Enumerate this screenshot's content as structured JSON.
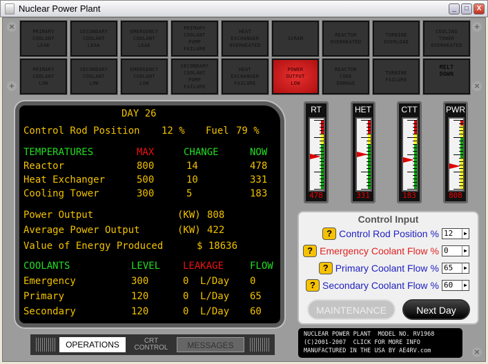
{
  "window": {
    "title": "Nuclear Power Plant",
    "min": "_",
    "max": "□",
    "close": "X"
  },
  "alarms": [
    {
      "label": "PRIMARY\nCOOLANT\nLEAK",
      "active": false
    },
    {
      "label": "SECONDARY\nCOOLANT\nLEAK",
      "active": false
    },
    {
      "label": "EMERGENCY\nCOOLANT\nLEAK",
      "active": false
    },
    {
      "label": "PRIMARY\nCOOLANT\nPUMP\nFAILURE",
      "active": false
    },
    {
      "label": "HEAT\nEXCHANGER\nOVERHEATED",
      "active": false
    },
    {
      "label": "SCRAM",
      "active": false
    },
    {
      "label": "REACTOR\nOVERHEATED",
      "active": false
    },
    {
      "label": "TURBINE\nOVERLOAD",
      "active": false
    },
    {
      "label": "COOLING\nTOWER\nOVERHEATED",
      "active": false
    },
    {
      "label": "PRIMARY\nCOOLANT\nLOW",
      "active": false
    },
    {
      "label": "SECONDARY\nCOOLANT\nLOW",
      "active": false
    },
    {
      "label": "EMERGENCY\nCOOLANT\nLOW",
      "active": false
    },
    {
      "label": "SECONDARY\nCOOLANT\nPUMP\nFAILURE",
      "active": false
    },
    {
      "label": "HEAT\nEXCHANGER\nFAILURE",
      "active": false
    },
    {
      "label": "POWER\nOUTPUT\nLOW",
      "active": true
    },
    {
      "label": "REACTOR\nCORE\nDAMAGE",
      "active": false
    },
    {
      "label": "TURBINE\nFAILURE",
      "active": false
    },
    {
      "label": "MELT\nDOWN",
      "active": false
    }
  ],
  "crt": {
    "day": "DAY 26",
    "rod_label": "Control Rod Position",
    "rod_value": "12 %",
    "fuel_label": "Fuel",
    "fuel_value": "79 %",
    "temp_headers": {
      "label": "TEMPERATURES",
      "max": "MAX",
      "change": "CHANGE",
      "now": "NOW"
    },
    "temps": [
      {
        "name": "Reactor",
        "max": "800",
        "change": "14",
        "now": "478"
      },
      {
        "name": "Heat Exchanger",
        "max": "500",
        "change": "10",
        "now": "331"
      },
      {
        "name": "Cooling Tower",
        "max": "300",
        "change": "5",
        "now": "183"
      }
    ],
    "power_output": {
      "label": "Power Output",
      "unit": "(KW)",
      "value": "808"
    },
    "avg_power": {
      "label": "Average Power Output",
      "unit": "(KW)",
      "value": "422"
    },
    "energy_value": {
      "label": "Value of Energy Produced",
      "value": "$ 18636"
    },
    "coolant_headers": {
      "label": "COOLANTS",
      "level": "LEVEL",
      "leakage": "LEAKAGE",
      "flow": "FLOW"
    },
    "coolants": [
      {
        "name": "Emergency",
        "level": "300",
        "leak": "0",
        "unit": "L/Day",
        "flow": "0"
      },
      {
        "name": "Primary",
        "level": "120",
        "leak": "0",
        "unit": "L/Day",
        "flow": "65"
      },
      {
        "name": "Secondary",
        "level": "120",
        "leak": "0",
        "unit": "L/Day",
        "flow": "60"
      }
    ]
  },
  "gauges": [
    {
      "label": "RT",
      "reading": "478",
      "level": 0.47
    },
    {
      "label": "HET",
      "reading": "331",
      "level": 0.5
    },
    {
      "label": "CTT",
      "reading": "183",
      "level": 0.42
    },
    {
      "label": "PWR",
      "reading": "808",
      "level": 0.33
    }
  ],
  "control": {
    "title": "Control Input",
    "help": "?",
    "pct": "%",
    "inputs": [
      {
        "label": "Control Rod Position",
        "value": "12",
        "color": "#2020c0"
      },
      {
        "label": "Emergency Coolant Flow",
        "value": "0",
        "color": "#e02020"
      },
      {
        "label": "Primary Coolant Flow",
        "value": "65",
        "color": "#2020c0"
      },
      {
        "label": "Secondary Coolant Flow",
        "value": "60",
        "color": "#2020c0"
      }
    ],
    "maintenance": "MAINTENANCE",
    "next_day": "Next Day"
  },
  "plate": [
    "NUCLEAR POWER PLANT  MODEL NO. RV1968",
    "(C)2001-2007  CLICK FOR MORE INFO",
    "MANUFACTURED IN THE USA BY AE4RV.com"
  ],
  "tabs": {
    "operations": "OPERATIONS",
    "crt_control": "CRT\nCONTROL",
    "messages": "MESSAGES"
  }
}
